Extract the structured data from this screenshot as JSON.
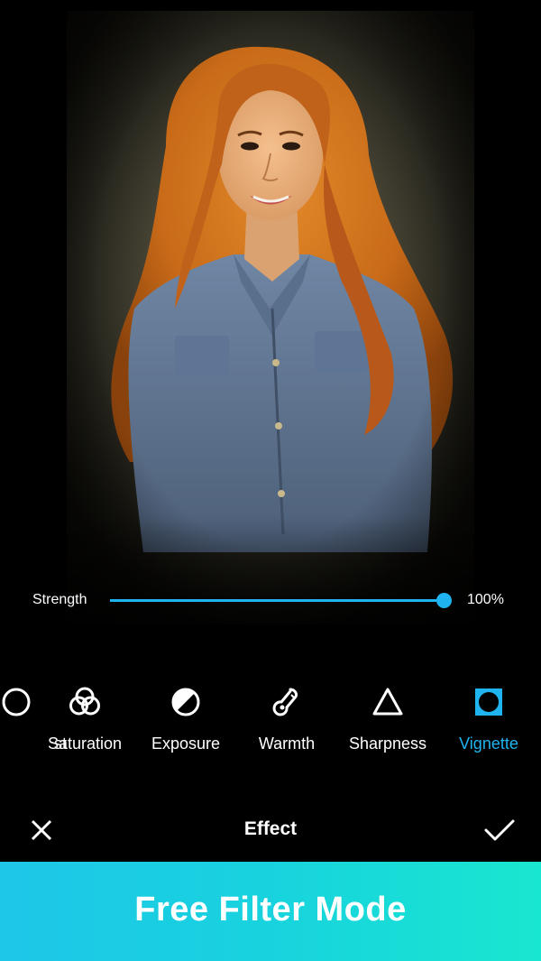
{
  "slider": {
    "label": "Strength",
    "value_text": "100%",
    "value_fraction": 1.0,
    "accent_color": "#1fb4ef"
  },
  "tools": [
    {
      "label": "st",
      "icon": "contrast-icon",
      "active": false
    },
    {
      "label": "Saturation",
      "icon": "saturation-icon",
      "active": false
    },
    {
      "label": "Exposure",
      "icon": "exposure-icon",
      "active": false
    },
    {
      "label": "Warmth",
      "icon": "thermometer-icon",
      "active": false
    },
    {
      "label": "Sharpness",
      "icon": "triangle-icon",
      "active": false
    },
    {
      "label": "Vignette",
      "icon": "vignette-icon",
      "active": true
    }
  ],
  "bottom_bar": {
    "title": "Effect",
    "cancel_icon": "close-icon",
    "confirm_icon": "checkmark-icon"
  },
  "banner": {
    "text": "Free Filter Mode",
    "gradient": [
      "#1ec6e8",
      "#19e6cf"
    ]
  }
}
